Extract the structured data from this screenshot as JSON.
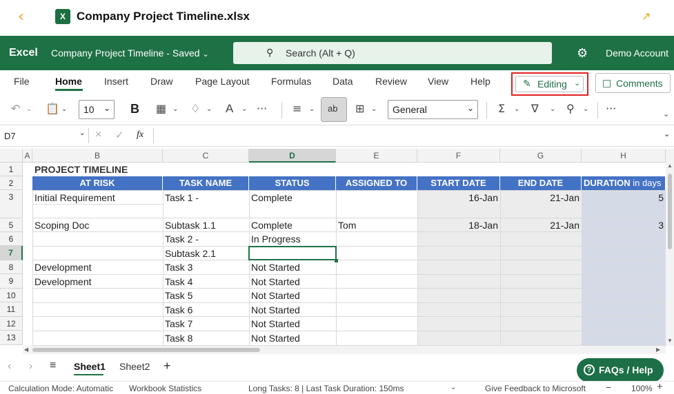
{
  "topbar": {
    "back_icon": "‹",
    "file_title": "Company Project Timeline.xlsx",
    "xl_badge": "X"
  },
  "greenbar": {
    "app": "Excel",
    "workbook": "Company Project Timeline",
    "saved": "Saved",
    "search_placeholder": "Search (Alt + Q)",
    "account": "Demo Account"
  },
  "menu": {
    "items": [
      "File",
      "Home",
      "Insert",
      "Draw",
      "Page Layout",
      "Formulas",
      "Data",
      "Review",
      "View",
      "Help"
    ],
    "active": "Home",
    "editing": "Editing",
    "comments": "Comments"
  },
  "toolbar": {
    "font_size": "10",
    "bold": "B",
    "font_color": "A",
    "more": "···",
    "number_format": "General"
  },
  "formula": {
    "name_box": "D7",
    "fx": "fx",
    "value": ""
  },
  "grid": {
    "columns": [
      "A",
      "B",
      "C",
      "D",
      "E",
      "F",
      "G",
      "H"
    ],
    "selected_column": "D",
    "rows": [
      "1",
      "2",
      "3",
      "",
      "5",
      "6",
      "7",
      "8",
      "9",
      "10",
      "11",
      "12",
      "13"
    ],
    "selected_row": "7",
    "title": "PROJECT TIMELINE",
    "headers": [
      "AT RISK",
      "TASK NAME",
      "STATUS",
      "ASSIGNED TO",
      "START DATE",
      "END DATE",
      "DURATION",
      "in days"
    ],
    "data": [
      {
        "b": "Initial Requirement",
        "c": "Task 1 -",
        "d": "Complete",
        "e": "",
        "f": "16-Jan",
        "g": "21-Jan",
        "h": "5"
      },
      {
        "b": "Scoping Doc",
        "c": "Subtask 1.1",
        "d": "Complete",
        "e": "Tom",
        "f": "18-Jan",
        "g": "21-Jan",
        "h": "3"
      },
      {
        "b": "",
        "c": "Task 2 -",
        "d": "In Progress",
        "e": "",
        "f": "",
        "g": "",
        "h": ""
      },
      {
        "b": "",
        "c": "Subtask 2.1",
        "d": "",
        "e": "",
        "f": "",
        "g": "",
        "h": ""
      },
      {
        "b": "Development",
        "c": "Task 3",
        "d": "Not Started",
        "e": "",
        "f": "",
        "g": "",
        "h": ""
      },
      {
        "b": "Development",
        "c": "Task 4",
        "d": "Not Started",
        "e": "",
        "f": "",
        "g": "",
        "h": ""
      },
      {
        "b": "",
        "c": "Task 5",
        "d": "Not Started",
        "e": "",
        "f": "",
        "g": "",
        "h": ""
      },
      {
        "b": "",
        "c": "Task 6",
        "d": "Not Started",
        "e": "",
        "f": "",
        "g": "",
        "h": ""
      },
      {
        "b": "",
        "c": "Task 7",
        "d": "Not Started",
        "e": "",
        "f": "",
        "g": "",
        "h": ""
      },
      {
        "b": "",
        "c": "Task 8",
        "d": "Not Started",
        "e": "",
        "f": "",
        "g": "",
        "h": ""
      }
    ]
  },
  "sheets": {
    "tabs": [
      "Sheet1",
      "Sheet2"
    ],
    "active": "Sheet1",
    "add": "+"
  },
  "faq": "FAQs / Help",
  "status": {
    "calc": "Calculation Mode: Automatic",
    "stats": "Workbook Statistics",
    "tasks": "Long Tasks: 8 | Last Task Duration: 150ms",
    "feedback": "Give Feedback to Microsoft",
    "zoom": "100%",
    "minus": "−",
    "plus": "+"
  },
  "colors": {
    "brand": "#1e7145",
    "header_blue": "#4472c4",
    "gray_fill": "#ececec",
    "duration_fill": "#d5dbe6",
    "highlight": "#e02020"
  }
}
